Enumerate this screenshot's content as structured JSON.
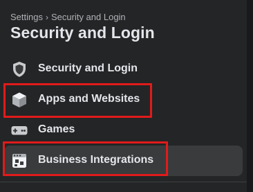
{
  "breadcrumb": {
    "parent": "Settings",
    "separator": "›",
    "current": "Security and Login"
  },
  "page_title": "Security and Login",
  "nav": {
    "items": [
      {
        "label": "Security and Login",
        "icon": "shield-icon",
        "active": false,
        "annotated": false
      },
      {
        "label": "Apps and Websites",
        "icon": "cube-icon",
        "active": false,
        "annotated": true
      },
      {
        "label": "Games",
        "icon": "gamepad-icon",
        "active": false,
        "annotated": false
      },
      {
        "label": "Business Integrations",
        "icon": "business-integrations-icon",
        "active": true,
        "annotated": true
      }
    ]
  },
  "colors": {
    "background": "#242526",
    "active_item": "#3a3b3c",
    "text_primary": "#e4e6eb",
    "text_secondary": "#b0b3b8",
    "annotation": "#e01b1b"
  }
}
